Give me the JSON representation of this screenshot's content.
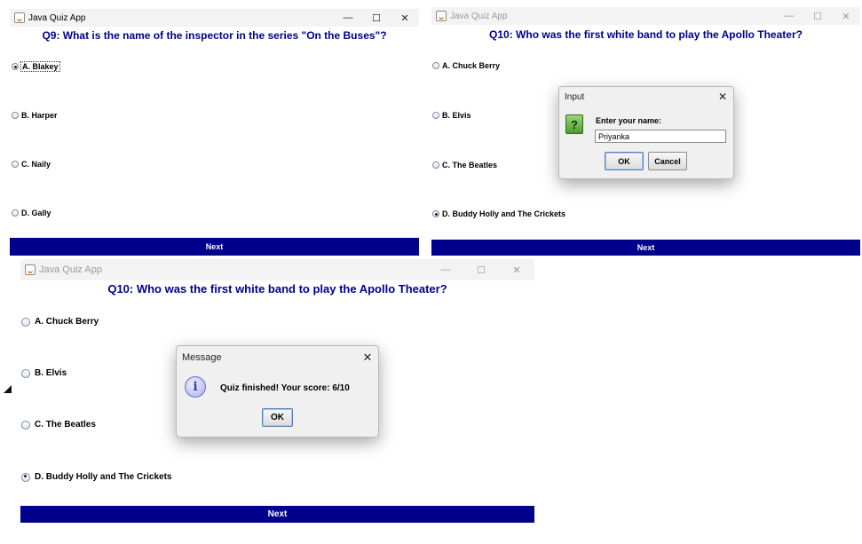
{
  "w1": {
    "title": "Java Quiz App",
    "controls": {
      "minimize": "—",
      "maximize": "☐",
      "close": "✕"
    },
    "question": "Q9: What is the name of the inspector in the series \"On the Buses\"?",
    "options": [
      "A. Blakey",
      "B. Harper",
      "C. Naily",
      "D. Gally"
    ],
    "selected_index": 0,
    "next_label": "Next"
  },
  "w2": {
    "title": "Java Quiz App",
    "controls": {
      "minimize": "—",
      "maximize": "☐",
      "close": "✕"
    },
    "question": "Q10: Who was the first white band to play the Apollo Theater?",
    "options": [
      "A. Chuck Berry",
      "B. Elvis",
      "C. The Beatles",
      "D. Buddy Holly and The Crickets"
    ],
    "selected_index": 3,
    "next_label": "Next",
    "input_dialog": {
      "title": "Input",
      "close": "✕",
      "icon": "question-icon",
      "icon_glyph": "?",
      "prompt": "Enter your name:",
      "value": "Priyanka",
      "ok_label": "OK",
      "cancel_label": "Cancel"
    }
  },
  "w3": {
    "title": "Java Quiz App",
    "controls": {
      "minimize": "—",
      "maximize": "☐",
      "close": "✕"
    },
    "question": "Q10: Who was the first white band to play the Apollo Theater?",
    "options": [
      "A. Chuck Berry",
      "B. Elvis",
      "C. The Beatles",
      "D. Buddy Holly and The Crickets"
    ],
    "selected_index": 3,
    "next_label": "Next",
    "message_dialog": {
      "title": "Message",
      "close": "✕",
      "icon": "info-icon",
      "icon_glyph": "i",
      "text": "Quiz finished! Your score: 6/10",
      "ok_label": "OK"
    }
  }
}
